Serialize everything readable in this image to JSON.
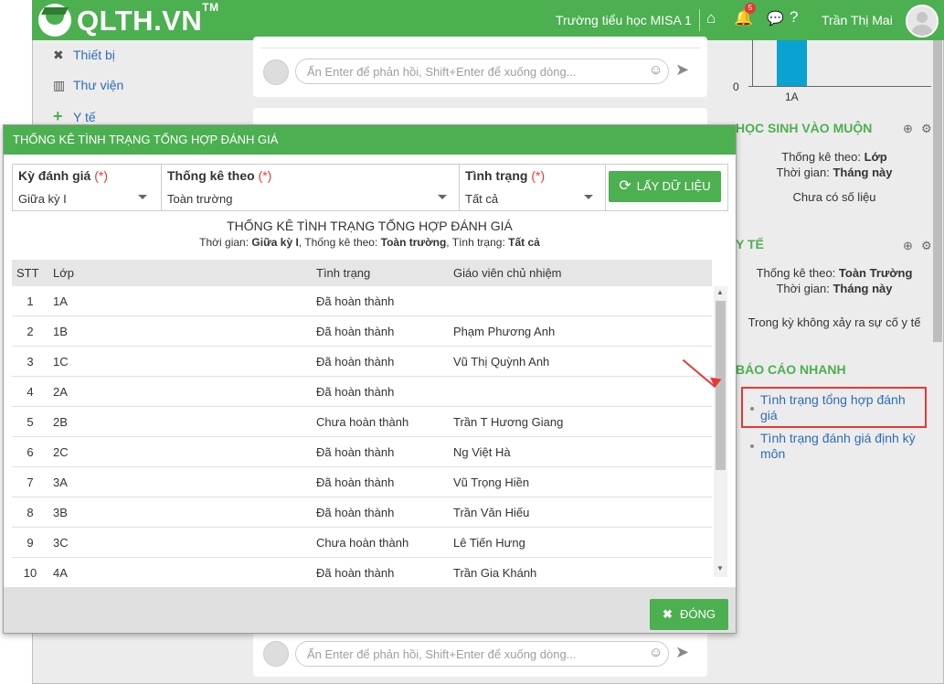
{
  "header": {
    "brand": "QLTH.VN",
    "brand_tm": "TM",
    "school": "Trường tiểu học MISA 1",
    "notification_count": "5",
    "user_name": "Trần Thị Mai"
  },
  "sidebar": {
    "items": [
      {
        "label": "Thiết bị"
      },
      {
        "label": "Thư viện"
      },
      {
        "label": "Y tế"
      }
    ]
  },
  "feed": {
    "reply_placeholder": "Ấn Enter để phản hồi, Shift+Enter để xuống dòng..."
  },
  "right_panel": {
    "chart": {
      "y_zero": "0",
      "category": "1A"
    },
    "late": {
      "title": "HỌC SINH VÀO MUỘN",
      "stat_by_label": "Thống kê theo: ",
      "stat_by": "Lớp",
      "time_label": "Thời gian: ",
      "time": "Tháng này",
      "empty": "Chưa có số liệu"
    },
    "health": {
      "title": "Y TẾ",
      "stat_by_label": "Thống kê theo: ",
      "stat_by": "Toàn Trường",
      "time_label": "Thời gian: ",
      "time": "Tháng này",
      "note": "Trong kỳ không xảy ra sự cố y tế"
    },
    "quick": {
      "title": "BÁO CÁO NHANH",
      "links": [
        {
          "label": "Tình trạng tổng hợp đánh giá"
        },
        {
          "label": "Tình trạng đánh giá định kỳ môn"
        }
      ]
    }
  },
  "modal": {
    "title": "THỐNG KÊ TÌNH TRẠNG TỔNG HỢP ĐÁNH GIÁ",
    "filters": {
      "period_label": "Kỳ đánh giá",
      "period_value": "Giữa kỳ I",
      "statby_label": "Thống kê theo",
      "statby_value": "Toàn trường",
      "status_label": "Tình trạng",
      "status_value": "Tất cả",
      "required_mark": "(*)",
      "get_data_label": "LẤY DỮ LIỆU"
    },
    "report_title": "THỐNG KÊ TÌNH TRẠNG TỔNG HỢP ĐÁNH GIÁ",
    "report_sub": {
      "time_label": "Thời gian: ",
      "time": "Giữa kỳ I",
      "by_label": ", Thống kê theo: ",
      "by": "Toàn trường",
      "status_label": ", Tình trạng: ",
      "status": "Tất cả"
    },
    "columns": {
      "stt": "STT",
      "class": "Lớp",
      "status": "Tình trạng",
      "teacher": "Giáo viên chủ nhiệm"
    },
    "rows": [
      {
        "stt": "1",
        "class": "1A",
        "status": "Đã hoàn thành",
        "teacher": ""
      },
      {
        "stt": "2",
        "class": "1B",
        "status": "Đã hoàn thành",
        "teacher": "Phạm Phương Anh"
      },
      {
        "stt": "3",
        "class": "1C",
        "status": "Đã hoàn thành",
        "teacher": "Vũ Thị Quỳnh Anh"
      },
      {
        "stt": "4",
        "class": "2A",
        "status": "Đã hoàn thành",
        "teacher": ""
      },
      {
        "stt": "5",
        "class": "2B",
        "status": "Chưa hoàn thành",
        "teacher": "Trần T Hương Giang"
      },
      {
        "stt": "6",
        "class": "2C",
        "status": "Đã hoàn thành",
        "teacher": "Ng Việt Hà"
      },
      {
        "stt": "7",
        "class": "3A",
        "status": "Đã hoàn thành",
        "teacher": "Vũ Trọng Hiền"
      },
      {
        "stt": "8",
        "class": "3B",
        "status": "Đã hoàn thành",
        "teacher": "Trần Văn Hiếu"
      },
      {
        "stt": "9",
        "class": "3C",
        "status": "Chưa hoàn thành",
        "teacher": "Lê Tiến Hưng"
      },
      {
        "stt": "10",
        "class": "4A",
        "status": "Đã hoàn thành",
        "teacher": "Trần Gia Khánh"
      }
    ],
    "close_label": "ĐÓNG"
  },
  "colors": {
    "primary": "#4caf50",
    "link": "#2e6db4",
    "required": "#e53935",
    "bar": "#0aa2d3"
  }
}
